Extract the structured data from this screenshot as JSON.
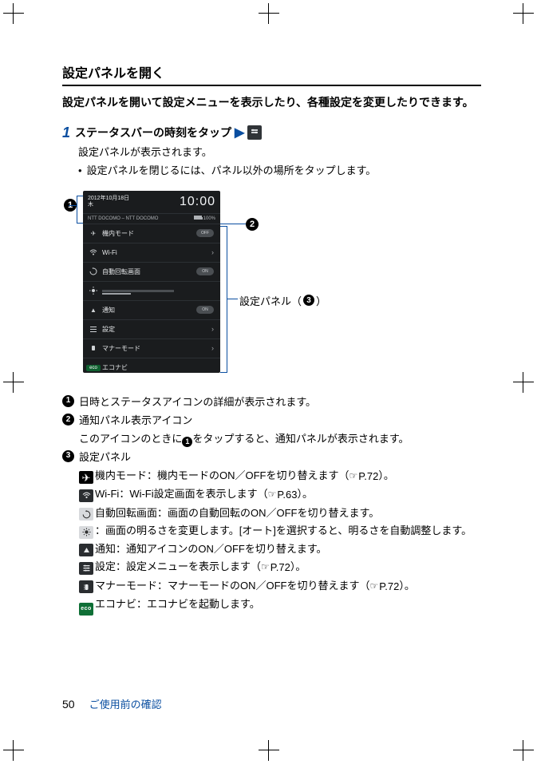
{
  "section_title": "設定パネルを開く",
  "intro": "設定パネルを開いて設定メニューを表示したり、各種設定を変更したりできます。",
  "step": {
    "number": "1",
    "text": "ステータスバーの時刻をタップ",
    "desc_lead": "設定パネルが表示されます。",
    "desc_bullet": "設定パネルを閉じるには、パネル以外の場所をタップします。"
  },
  "phone": {
    "date_line1": "2012年10月18日",
    "date_line2": "木",
    "clock": "10:00",
    "info_left": "NTT DOCOMO – NTT DOCOMO",
    "info_batt": "100%",
    "rows": [
      {
        "icon": "airplane",
        "label": "機内モード",
        "right": "OFF"
      },
      {
        "icon": "wifi",
        "label": "Wi-Fi",
        "right": ">"
      },
      {
        "icon": "rotate",
        "label": "自動回転画面",
        "right": "ON"
      },
      {
        "icon": "bright",
        "label": "",
        "right": "slider"
      },
      {
        "icon": "notify",
        "label": "通知",
        "right": "ON"
      },
      {
        "icon": "settings",
        "label": "設定",
        "right": ">"
      },
      {
        "icon": "manner",
        "label": "マナーモード",
        "right": ">"
      },
      {
        "icon": "eco",
        "label": "エコナビ",
        "right": ""
      }
    ]
  },
  "callouts": {
    "one": "❶",
    "two": "❷",
    "panel_label_prefix": "設定パネル（",
    "panel_label_num": "❸",
    "panel_label_suffix": "）"
  },
  "legend": {
    "item1": "日時とステータスアイコンの詳細が表示されます。",
    "item2_title": "通知パネル表示アイコン",
    "item2_body_a": "このアイコンのときに",
    "item2_body_b": "をタップすると、通知パネルが表示されます。",
    "item3_title": "設定パネル",
    "airplane": "機内モード：機内モードのON／OFFを切り替えます（",
    "airplane_ref": "P.72",
    "airplane_suffix": "）。",
    "wifi": "Wi-Fi：Wi-Fi設定画面を表示します（",
    "wifi_ref": "P.63",
    "wifi_suffix": "）。",
    "rotate": "自動回転画面：画面の自動回転のON／OFFを切り替えます。",
    "bright": "：画面の明るさを変更します。[オート]を選択すると、明るさを自動調整します。",
    "notify": "通知：通知アイコンのON／OFFを切り替えます。",
    "settings": "設定：設定メニューを表示します（",
    "settings_ref": "P.72",
    "settings_suffix": "）。",
    "manner": "マナーモード：マナーモードのON／OFFを切り替えます（",
    "manner_ref": "P.72",
    "manner_suffix": "）。",
    "eco": "エコナビ：エコナビを起動します。"
  },
  "footer": {
    "page": "50",
    "chapter": "ご使用前の確認"
  },
  "glyphs": {
    "bullet": "•",
    "hand": "☞"
  }
}
